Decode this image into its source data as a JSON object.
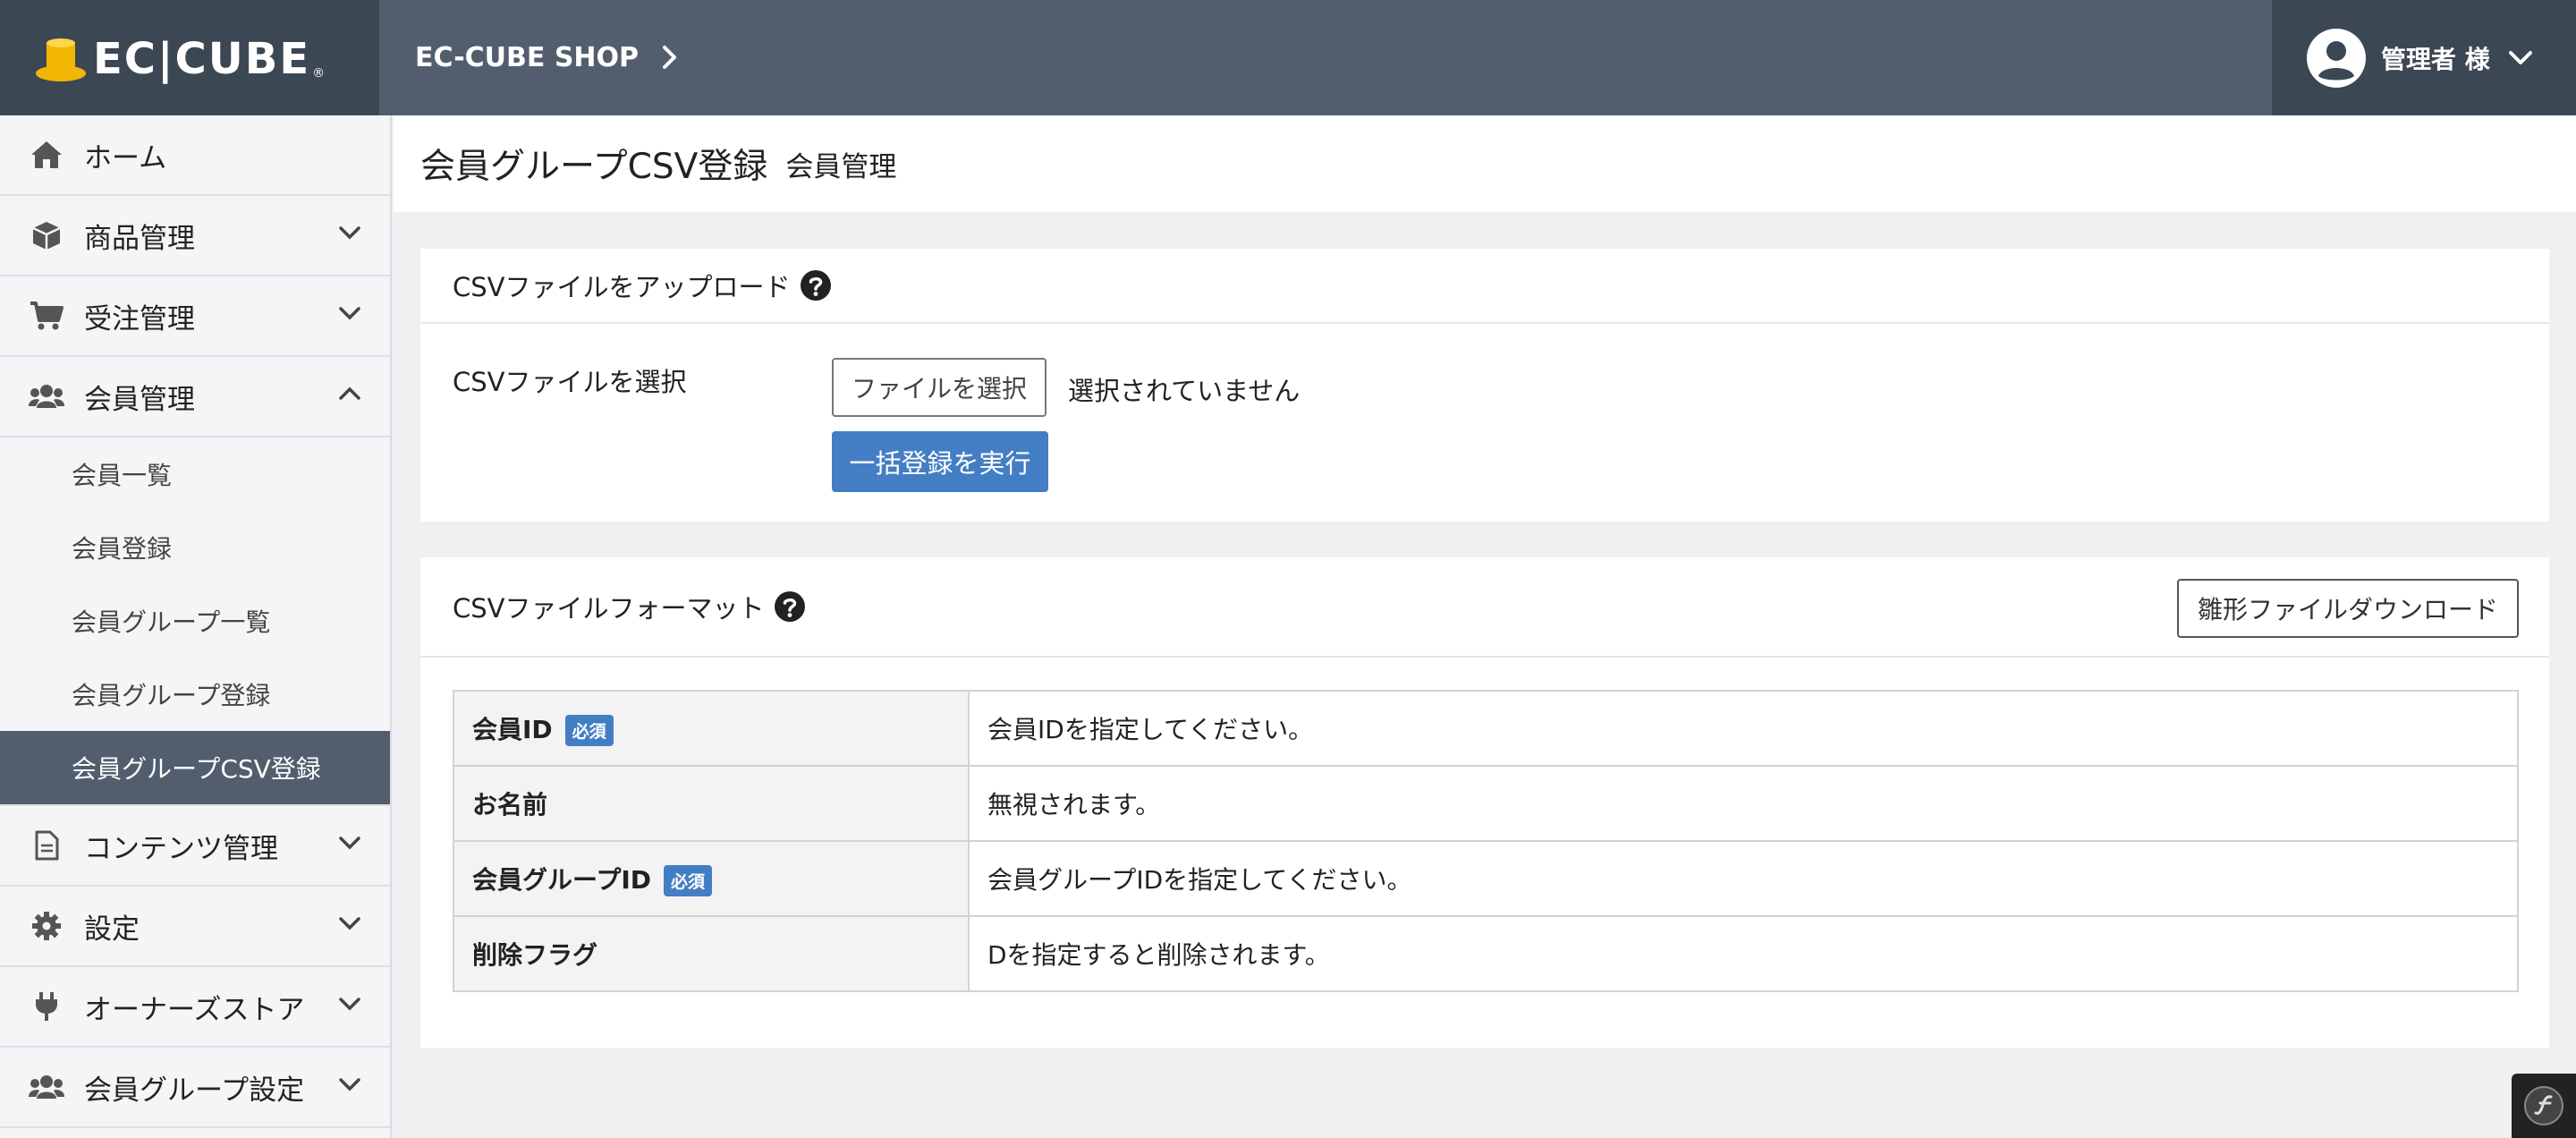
{
  "header": {
    "logo_text": "EC|CUBE",
    "logo_reg": "®",
    "shop_name": "EC-CUBE SHOP",
    "user_name": "管理者 様"
  },
  "sidebar": {
    "items": [
      {
        "label": "ホーム",
        "icon": "home-icon"
      },
      {
        "label": "商品管理",
        "icon": "box-icon"
      },
      {
        "label": "受注管理",
        "icon": "cart-icon"
      },
      {
        "label": "会員管理",
        "icon": "users-icon"
      },
      {
        "label": "コンテンツ管理",
        "icon": "file-icon"
      },
      {
        "label": "設定",
        "icon": "gear-icon"
      },
      {
        "label": "オーナーズストア",
        "icon": "plug-icon"
      },
      {
        "label": "会員グループ設定",
        "icon": "users-icon"
      }
    ],
    "sub_items": [
      {
        "label": "会員一覧"
      },
      {
        "label": "会員登録"
      },
      {
        "label": "会員グループ一覧"
      },
      {
        "label": "会員グループ登録"
      },
      {
        "label": "会員グループCSV登録"
      }
    ]
  },
  "page": {
    "title": "会員グループCSV登録",
    "subtitle": "会員管理"
  },
  "upload": {
    "heading": "CSVファイルをアップロード",
    "row_label": "CSVファイルを選択",
    "file_button": "ファイルを選択",
    "file_status": "選択されていません",
    "submit": "一括登録を実行"
  },
  "format": {
    "heading": "CSVファイルフォーマット",
    "download_button": "雛形ファイルダウンロード",
    "required_badge": "必須",
    "rows": [
      {
        "field": "会員ID",
        "required": true,
        "desc": "会員IDを指定してください。"
      },
      {
        "field": "お名前",
        "required": false,
        "desc": "無視されます。"
      },
      {
        "field": "会員グループID",
        "required": true,
        "desc": "会員グループIDを指定してください。"
      },
      {
        "field": "削除フラグ",
        "required": false,
        "desc": "Dを指定すると削除されます。"
      }
    ]
  },
  "colors": {
    "header": "#525e6e",
    "header_dark": "#3c4754",
    "accent": "#437ec4",
    "logo_gold": "#f2b705"
  }
}
